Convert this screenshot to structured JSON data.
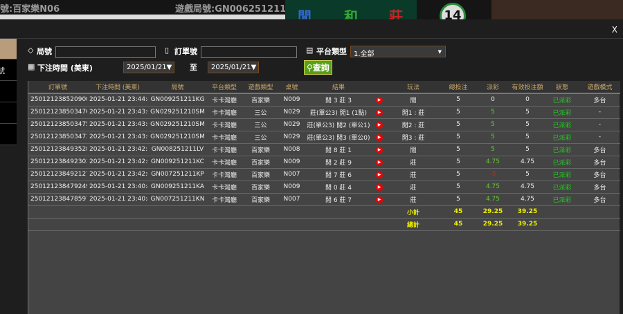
{
  "background": {
    "table_label": "號:百家樂N06",
    "round_label": "遊戲局號:GN006251211JB",
    "player": "閒",
    "tie": "和",
    "banker": "莊",
    "countdown": "14"
  },
  "modal": {
    "close_label": "X",
    "sidebar_fragment": "號"
  },
  "filters": {
    "round_label": "局號",
    "round_value": "",
    "order_label": "訂單號",
    "order_value": "",
    "platform_label": "平台類型",
    "platform_value": "1.全部",
    "time_label": "下注時間 (美東)",
    "date_from": "2025/01/21▼",
    "to_label": "至",
    "date_to": "2025/01/21▼",
    "search_label": "查詢"
  },
  "table": {
    "headers": [
      "訂單號",
      "下注時間 (美東)",
      "局號",
      "平台類型",
      "遊戲類型",
      "桌號",
      "結果",
      "",
      "玩法",
      "總投注",
      "派彩",
      "有效投注額",
      "狀態",
      "遊戲模式"
    ],
    "rows": [
      [
        "250121238520900",
        "2025-01-21 23:44:42",
        "GN009251211KG",
        "卡卡灣廳",
        "百家樂",
        "N009",
        "閒 3 莊 3",
        "閒",
        "5",
        "0",
        "0",
        "已派彩",
        "多台"
      ],
      [
        "250121238503476",
        "2025-01-21 23:43:08",
        "GN029251210SM",
        "卡卡灣廳",
        "三公",
        "N029",
        "莊(單公3) 閒1 (1點)",
        "閒1 : 莊",
        "5",
        "5",
        "5",
        "已派彩",
        "-"
      ],
      [
        "250121238503475",
        "2025-01-21 23:43:08",
        "GN029251210SM",
        "卡卡灣廳",
        "三公",
        "N029",
        "莊(單公3) 閒2 (單公1)",
        "閒2 : 莊",
        "5",
        "5",
        "5",
        "已派彩",
        "-"
      ],
      [
        "250121238503473",
        "2025-01-21 23:43:08",
        "GN029251210SM",
        "卡卡灣廳",
        "三公",
        "N029",
        "莊(單公3) 閒3 (單公0)",
        "閒3 : 莊",
        "5",
        "5",
        "5",
        "已派彩",
        "-"
      ],
      [
        "250121238493528",
        "2025-01-21 23:42:11",
        "GN008251211LV",
        "卡卡灣廳",
        "百家樂",
        "N008",
        "閒 8 莊 1",
        "閒",
        "5",
        "5",
        "5",
        "已派彩",
        "多台"
      ],
      [
        "250121238492303",
        "2025-01-21 23:42:02",
        "GN009251211KC",
        "卡卡灣廳",
        "百家樂",
        "N009",
        "閒 2 莊 9",
        "莊",
        "5",
        "4.75",
        "4.75",
        "已派彩",
        "多台"
      ],
      [
        "250121238492127",
        "2025-01-21 23:42:01",
        "GN007251211KP",
        "卡卡灣廳",
        "百家樂",
        "N007",
        "閒 7 莊 6",
        "莊",
        "5",
        "-5",
        "5",
        "已派彩",
        "多台"
      ],
      [
        "250121238479249",
        "2025-01-21 23:40:49",
        "GN009251211KA",
        "卡卡灣廳",
        "百家樂",
        "N009",
        "閒 0 莊 4",
        "莊",
        "5",
        "4.75",
        "4.75",
        "已派彩",
        "多台"
      ],
      [
        "250121238478597",
        "2025-01-21 23:40:45",
        "GN007251211KN",
        "卡卡灣廳",
        "百家樂",
        "N007",
        "閒 6 莊 7",
        "莊",
        "5",
        "4.75",
        "4.75",
        "已派彩",
        "多台"
      ]
    ],
    "subtotal": {
      "label": "小計",
      "total_bet": "45",
      "payout": "29.25",
      "valid": "39.25"
    },
    "grand_total": {
      "label": "總計",
      "total_bet": "45",
      "payout": "29.25",
      "valid": "39.25"
    }
  },
  "colors": {
    "header_text": "#c9a86a",
    "win": "#66cc33",
    "loss": "#cc2222",
    "status": "#22cc22",
    "totals": "#eeee00",
    "search_button": "#5aa01a"
  }
}
